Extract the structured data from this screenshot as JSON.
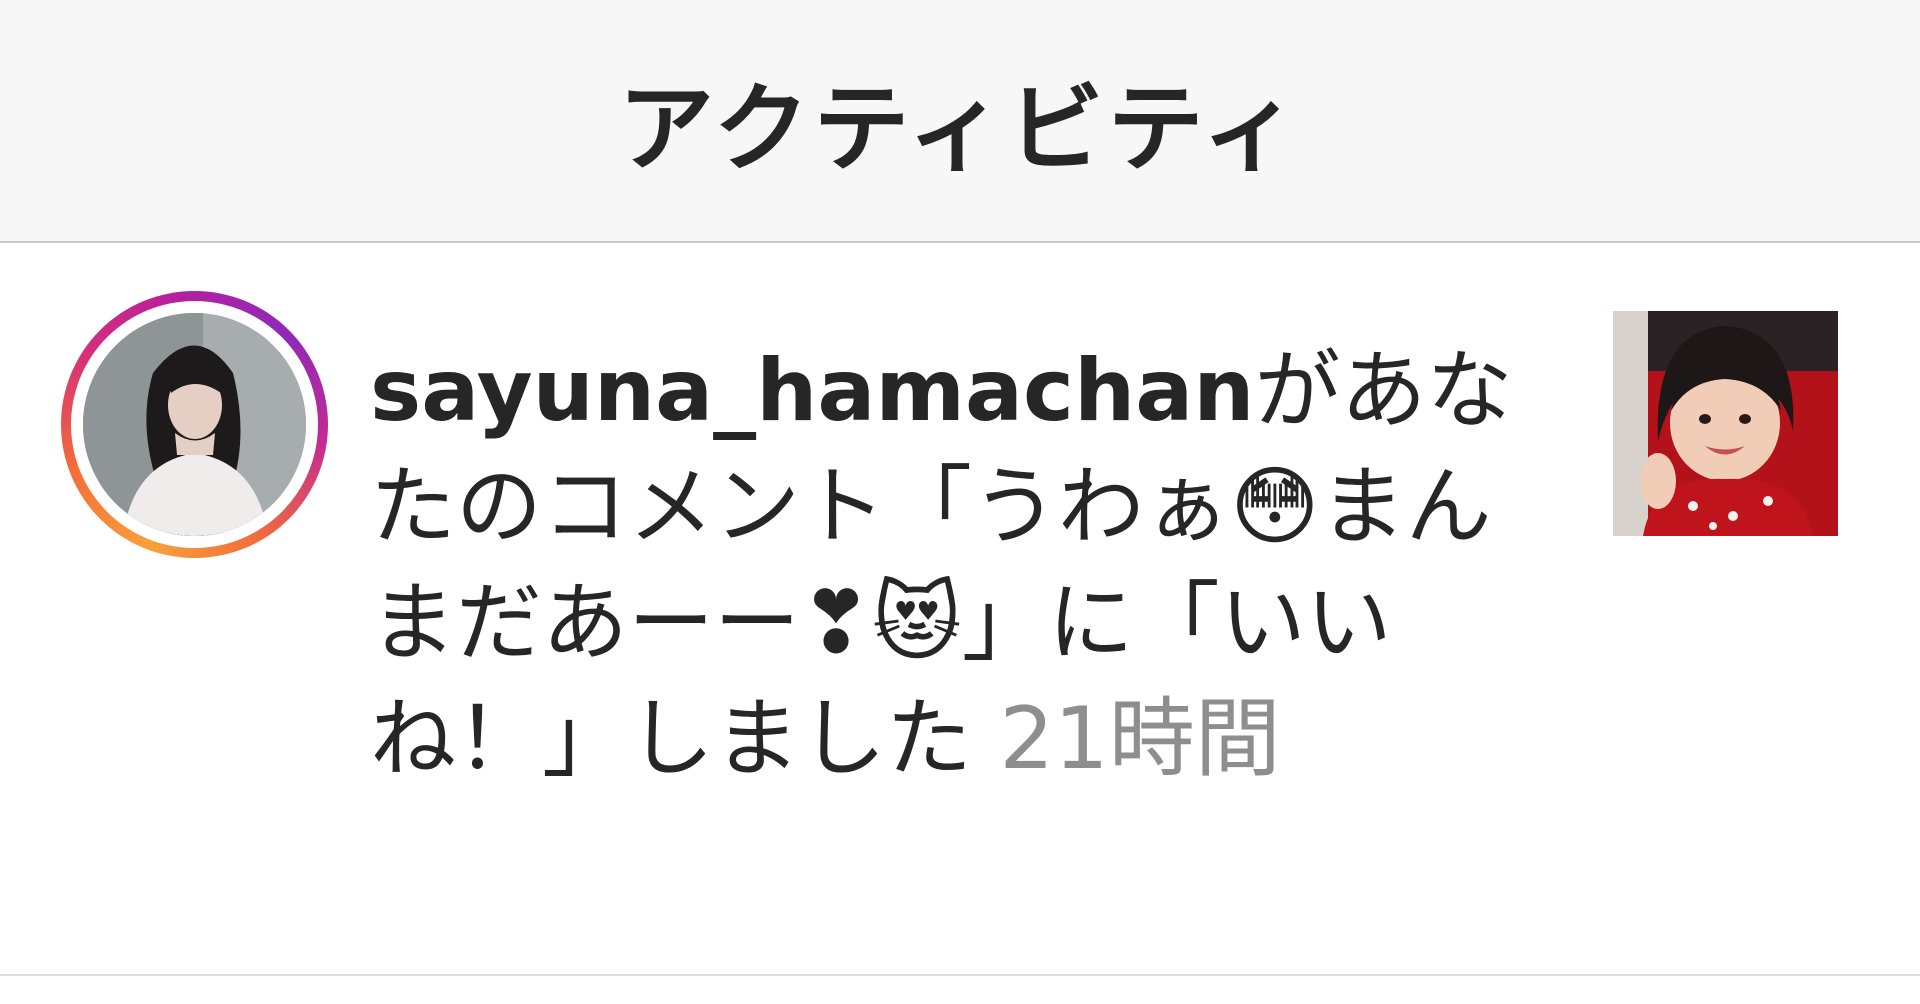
{
  "header": {
    "title": "アクティビティ"
  },
  "notification": {
    "username": "sayuna_hamachan",
    "text_before_comment": "があなたのコメント「",
    "comment": "うわぁ😳まんまだあーー❣😻",
    "text_after_comment": "」に「いいね！」しました",
    "timestamp": "21時間"
  },
  "icons": {
    "avatar": "profile-avatar",
    "thumbnail": "post-thumbnail"
  },
  "colors": {
    "header_background": "#f7f7f7",
    "text": "#262626",
    "timestamp": "#8e8e8e",
    "ring_gradient": [
      "#f9a13b",
      "#d62f7a",
      "#8d2ab8"
    ]
  }
}
